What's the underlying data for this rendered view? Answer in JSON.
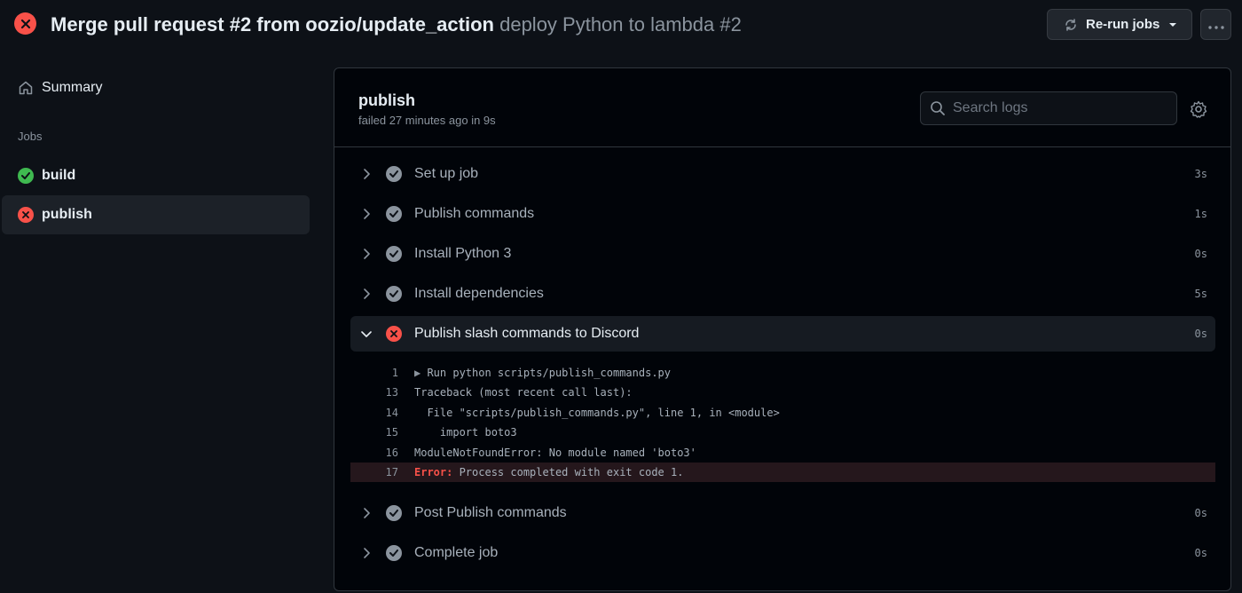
{
  "header": {
    "title_main": "Merge pull request #2 from oozio/update_action",
    "title_sub": "deploy Python to lambda #2",
    "rerun_label": "Re-run jobs"
  },
  "sidebar": {
    "summary_label": "Summary",
    "jobs_heading": "Jobs",
    "jobs": [
      {
        "label": "build",
        "status": "success"
      },
      {
        "label": "publish",
        "status": "failure"
      }
    ]
  },
  "job": {
    "title": "publish",
    "meta": "failed 27 minutes ago in 9s",
    "search_placeholder": "Search logs"
  },
  "steps": [
    {
      "name": "Set up job",
      "duration": "3s",
      "status": "success"
    },
    {
      "name": "Publish commands",
      "duration": "1s",
      "status": "success"
    },
    {
      "name": "Install Python 3",
      "duration": "0s",
      "status": "success"
    },
    {
      "name": "Install dependencies",
      "duration": "5s",
      "status": "success"
    },
    {
      "name": "Publish slash commands to Discord",
      "duration": "0s",
      "status": "failure"
    },
    {
      "name": "Post Publish commands",
      "duration": "0s",
      "status": "success"
    },
    {
      "name": "Complete job",
      "duration": "0s",
      "status": "success"
    }
  ],
  "log": [
    {
      "num": "1",
      "text": "Run python scripts/publish_commands.py"
    },
    {
      "num": "13",
      "text": "Traceback (most recent call last):"
    },
    {
      "num": "14",
      "text": "  File \"scripts/publish_commands.py\", line 1, in <module>"
    },
    {
      "num": "15",
      "text": "    import boto3"
    },
    {
      "num": "16",
      "text": "ModuleNotFoundError: No module named 'boto3'"
    },
    {
      "num": "17",
      "error_label": "Error:",
      "text": " Process completed with exit code 1."
    }
  ],
  "colors": {
    "failure": "#f85149",
    "success": "#3fb950",
    "background": "#0d1117"
  }
}
